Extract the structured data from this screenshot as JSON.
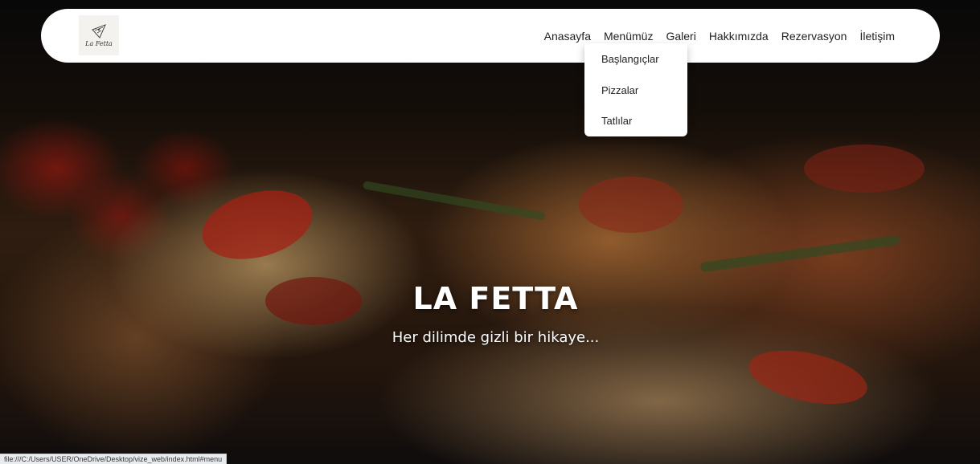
{
  "navbar": {
    "logo_icon": "pizza-slice-icon",
    "logo_text": "La Fetta",
    "links": [
      "Anasayfa",
      "Menümüz",
      "Galeri",
      "Hakkımızda",
      "Rezervasyon",
      "İletişim"
    ]
  },
  "dropdown": {
    "items": [
      "Başlangıçlar",
      "Pizzalar",
      "Tatlılar"
    ]
  },
  "hero": {
    "title": "LA FETTA",
    "subtitle": "Her dilimde gizli bir hikaye..."
  },
  "status_bar": {
    "url": "file:///C:/Users/USER/OneDrive/Desktop/vize_web/index.html#menu"
  },
  "colors": {
    "navbar_bg": "#ffffff",
    "text": "#222222",
    "hero_text": "#ffffff"
  }
}
